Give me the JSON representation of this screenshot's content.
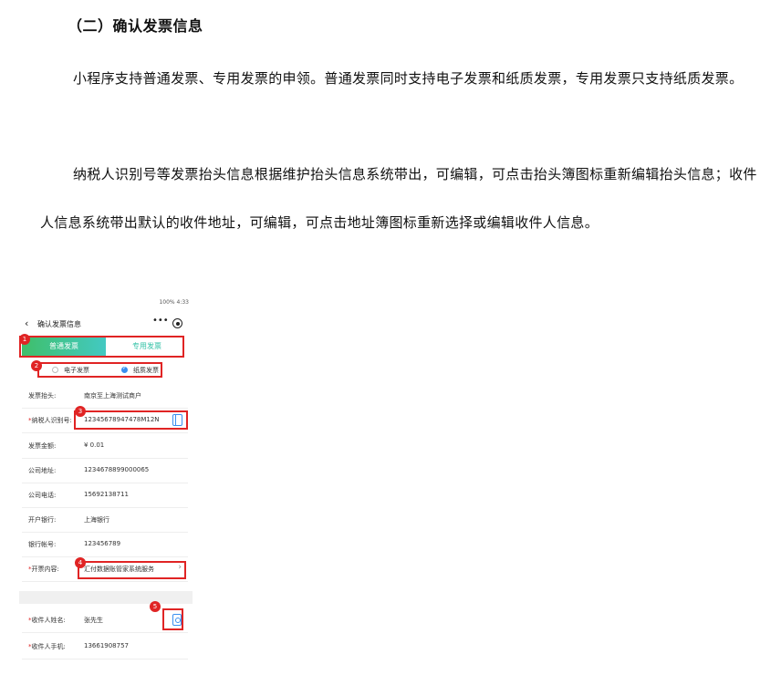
{
  "document": {
    "heading": "（二）确认发票信息",
    "paragraph1": "小程序支持普通发票、专用发票的申领。普通发票同时支持电子发票和纸质发票，专用发票只支持纸质发票。",
    "paragraph2": "纳税人识别号等发票抬头信息根据维护抬头信息系统带出，可编辑，可点击抬头簿图标重新编辑抬头信息；收件人信息系统带出默认的收件地址，可编辑，可点击地址簿图标重新选择或编辑收件人信息。"
  },
  "phone": {
    "status_bar": "100% 4:33",
    "title": "确认发票信息",
    "back_glyph": "‹",
    "more_glyph": "•••",
    "tabs": {
      "normal": "普通发票",
      "special": "专用发票"
    },
    "invoice_type": {
      "electronic": "电子发票",
      "paper": "纸质发票",
      "selected": "纸质发票"
    },
    "fields": [
      {
        "label": "发票抬头:",
        "value": "南京至上海测试商户",
        "required": false
      },
      {
        "label": "纳税人识别号:",
        "value": "12345678947478M12N",
        "required": true
      },
      {
        "label": "发票金额:",
        "value": "¥ 0.01",
        "required": false
      },
      {
        "label": "公司地址:",
        "value": "1234678899000065",
        "required": false
      },
      {
        "label": "公司电话:",
        "value": "15692138711",
        "required": false
      },
      {
        "label": "开户银行:",
        "value": "上海银行",
        "required": false
      },
      {
        "label": "银行帐号:",
        "value": "123456789",
        "required": false
      },
      {
        "label": "开票内容:",
        "value": "汇付数据账管家系统服务",
        "required": true
      }
    ],
    "recipient": [
      {
        "label": "收件人姓名:",
        "value": "张先生",
        "required": true
      },
      {
        "label": "收件人手机:",
        "value": "13661908757",
        "required": true
      }
    ],
    "required_mark": "*",
    "chevron": "›"
  },
  "annotations": [
    "1",
    "2",
    "3",
    "4",
    "5"
  ],
  "colors": {
    "red": "#e02424",
    "green": "#3fbf6a",
    "teal": "#34c2a7",
    "blue": "#3a8ff0"
  }
}
